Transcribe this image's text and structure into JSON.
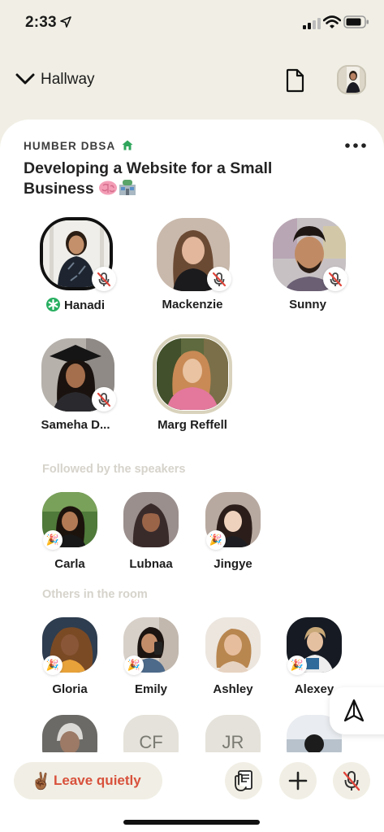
{
  "status_bar": {
    "time": "2:33"
  },
  "header": {
    "back_label": "Hallway"
  },
  "room": {
    "club": "HUMBER DBSA",
    "title": "Developing a Website for a Small Business"
  },
  "speakers": [
    {
      "name": "Hanadi",
      "moderator": true
    },
    {
      "name": "Mackenzie"
    },
    {
      "name": "Sunny"
    },
    {
      "name": "Sameha D..."
    },
    {
      "name": "Marg Reffell"
    }
  ],
  "followed_section": {
    "heading": "Followed by the speakers",
    "people": [
      {
        "name": "Carla"
      },
      {
        "name": "Lubnaa"
      },
      {
        "name": "Jingye"
      }
    ]
  },
  "others_section": {
    "heading": "Others in the room",
    "people": [
      {
        "name": "Gloria"
      },
      {
        "name": "Emily"
      },
      {
        "name": "Ashley"
      },
      {
        "name": "Alexey"
      }
    ],
    "partial_row": [
      {
        "initials": "CF"
      },
      {
        "initials": "JR"
      }
    ]
  },
  "bottom": {
    "leave_label": "Leave quietly",
    "leave_emoji": "✌🏾"
  },
  "icons": {
    "back": "chevron-down-icon",
    "document": "document-icon",
    "more": "more-dots-icon",
    "muted": "mic-off-icon",
    "share": "share-ping-icon",
    "raise_hand": "raise-hand-icon",
    "add": "plus-icon",
    "mic": "mic-off-icon"
  },
  "colors": {
    "background": "#f1efe5",
    "leave_text": "#d8513c",
    "moderator_green": "#27ae60",
    "muted_red": "#e0443a"
  }
}
